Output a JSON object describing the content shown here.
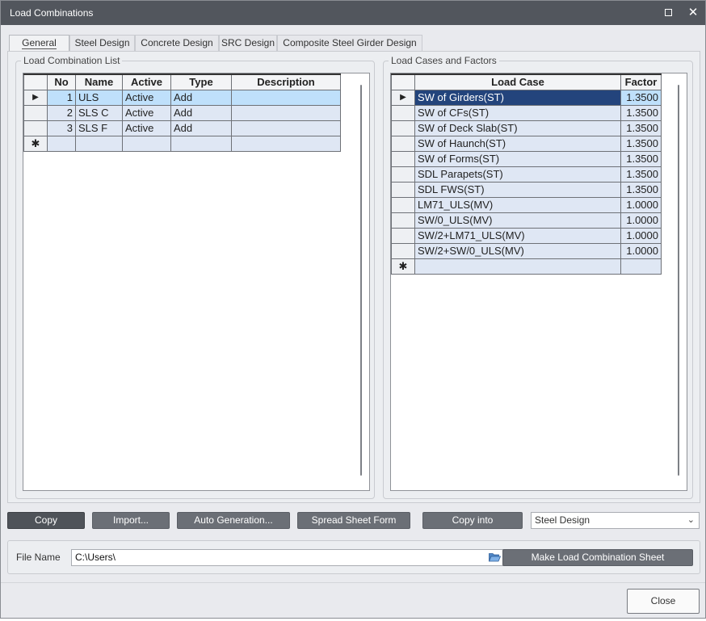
{
  "window": {
    "title": "Load Combinations"
  },
  "tabs": [
    {
      "label": "General",
      "active": true
    },
    {
      "label": "Steel Design",
      "active": false
    },
    {
      "label": "Concrete Design",
      "active": false
    },
    {
      "label": "SRC Design",
      "active": false
    },
    {
      "label": "Composite Steel Girder Design",
      "active": false
    }
  ],
  "combination_list": {
    "title": "Load Combination List",
    "columns": [
      "No",
      "Name",
      "Active",
      "Type",
      "Description"
    ],
    "rows": [
      {
        "no": "1",
        "name": "ULS",
        "active": "Active",
        "type": "Add",
        "description": ""
      },
      {
        "no": "2",
        "name": "SLS C",
        "active": "Active",
        "type": "Add",
        "description": ""
      },
      {
        "no": "3",
        "name": "SLS F",
        "active": "Active",
        "type": "Add",
        "description": ""
      }
    ],
    "selected_row": 0,
    "new_row_marker": "✱",
    "current_marker": "▶"
  },
  "load_cases": {
    "title": "Load Cases and Factors",
    "columns": [
      "Load Case",
      "Factor"
    ],
    "rows": [
      {
        "case": "SW of Girders(ST)",
        "factor": "1.3500"
      },
      {
        "case": "SW of CFs(ST)",
        "factor": "1.3500"
      },
      {
        "case": "SW of Deck Slab(ST)",
        "factor": "1.3500"
      },
      {
        "case": "SW of Haunch(ST)",
        "factor": "1.3500"
      },
      {
        "case": "SW of Forms(ST)",
        "factor": "1.3500"
      },
      {
        "case": "SDL Parapets(ST)",
        "factor": "1.3500"
      },
      {
        "case": "SDL FWS(ST)",
        "factor": "1.3500"
      },
      {
        "case": "LM71_ULS(MV)",
        "factor": "1.0000"
      },
      {
        "case": "SW/0_ULS(MV)",
        "factor": "1.0000"
      },
      {
        "case": "SW/2+LM71_ULS(MV)",
        "factor": "1.0000"
      },
      {
        "case": "SW/2+SW/0_ULS(MV)",
        "factor": "1.0000"
      }
    ],
    "selected_row": 0,
    "new_row_marker": "✱",
    "current_marker": "▶"
  },
  "actions": {
    "copy": "Copy",
    "import": "Import...",
    "auto_generation": "Auto Generation...",
    "spread_sheet_form": "Spread Sheet Form",
    "copy_into": "Copy into",
    "copy_into_target": "Steel Design"
  },
  "file": {
    "label": "File Name",
    "value": "C:\\Users\\",
    "make_sheet": "Make Load Combination Sheet"
  },
  "footer": {
    "close": "Close"
  },
  "icons": {
    "maximize": "maximize-icon",
    "close": "close-icon",
    "folder": "folder-open-icon",
    "dropdown": "chevron-down-icon"
  },
  "colors": {
    "titlebar": "#52565d",
    "button": "#6b6f76",
    "selected_row": "#bfe0fb",
    "selected_case": "#23447c",
    "row_bg": "#dfe7f4"
  }
}
